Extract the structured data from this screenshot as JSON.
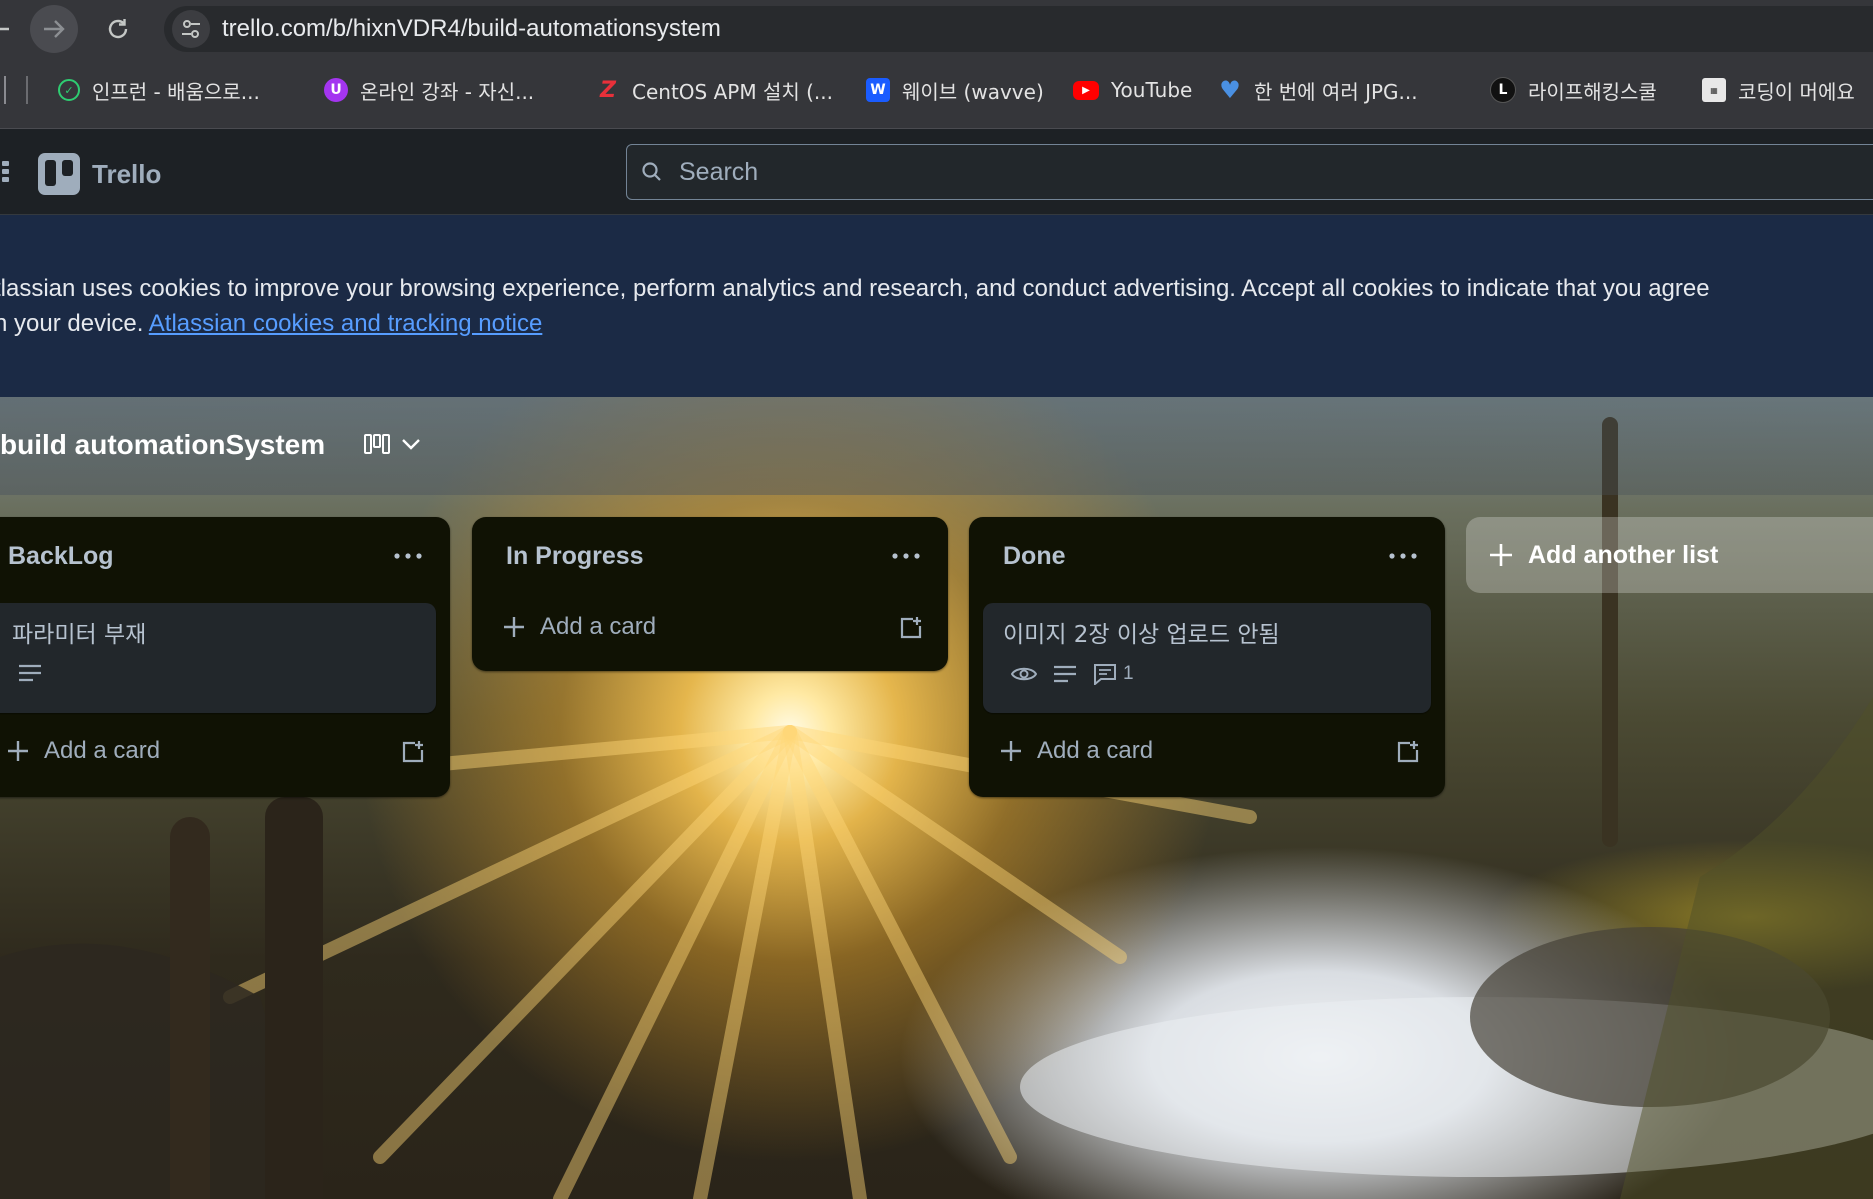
{
  "browser": {
    "url": "trello.com/b/hixnVDR4/build-automationsystem",
    "bookmarks": [
      {
        "label": "인프런 - 배움으로...",
        "icon": "inflearn-icon",
        "color": "#2ecc71"
      },
      {
        "label": "온라인 강좌 - 자신...",
        "icon": "udemy-icon",
        "color": "#a435f0"
      },
      {
        "label": "CentOS APM 설치 (...",
        "icon": "z-icon",
        "color": "#e8303a"
      },
      {
        "label": "웨이브 (wavve)",
        "icon": "wavve-icon",
        "color": "#1a5cff"
      },
      {
        "label": "YouTube",
        "icon": "youtube-icon",
        "color": "#ff0000"
      },
      {
        "label": "한 번에 여러 JPG...",
        "icon": "heart-icon",
        "color": "#4a90e2"
      },
      {
        "label": "라이프해킹스쿨",
        "icon": "l-icon",
        "color": "#111111"
      },
      {
        "label": "코딩이 머에요",
        "icon": "coding-icon",
        "color": "#dddddd"
      }
    ]
  },
  "header": {
    "app_name": "Trello",
    "search_placeholder": "Search"
  },
  "cookie_banner": {
    "text_line1": "tlassian uses cookies to improve your browsing experience, perform analytics and research, and conduct advertising. Accept all cookies to indicate that you agree",
    "text_line2": "n your device. ",
    "link": "Atlassian cookies and tracking notice"
  },
  "board": {
    "name": "build automationSystem",
    "lists": [
      {
        "title": "BackLog",
        "cards": [
          {
            "title": "파라미터 부재",
            "has_description": true
          }
        ],
        "add_card_label": "Add a card"
      },
      {
        "title": "In Progress",
        "cards": [],
        "add_card_label": "Add a card"
      },
      {
        "title": "Done",
        "cards": [
          {
            "title": "이미지 2장 이상 업로드 안됨",
            "watching": true,
            "has_description": true,
            "comments": "1"
          }
        ],
        "add_card_label": "Add a card"
      }
    ],
    "add_list_label": "Add another list"
  },
  "colors": {
    "list_bg": "#101204",
    "card_bg": "#22272b",
    "link": "#579dff",
    "cookie_bg": "#1b2a45"
  }
}
